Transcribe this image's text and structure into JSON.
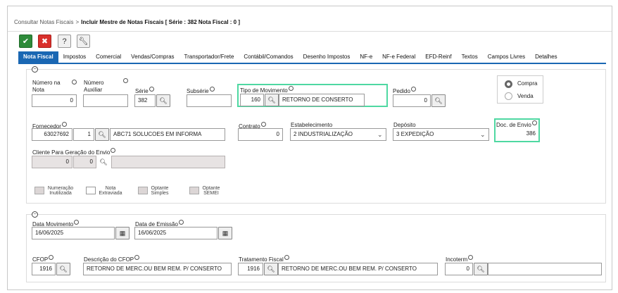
{
  "breadcrumb": {
    "parent": "Consultar Notas Fiscais",
    "separator": ">",
    "current": "Incluir Mestre de Notas Fiscais [ Série : 382 Nota Fiscal : 0 ]"
  },
  "toolbar": {
    "confirm_icon": "check-icon",
    "cancel_icon": "close-icon",
    "help_label": "?",
    "tools_icon": "wrench-icon"
  },
  "tabs": [
    "Nota Fiscal",
    "Impostos",
    "Comercial",
    "Vendas/Compras",
    "Transportador/Frete",
    "Contábil/Comandos",
    "Desenho Impostos",
    "NF-e",
    "NF-e Federal",
    "EFD-Reinf",
    "Textos",
    "Campos Livres",
    "Detalhes"
  ],
  "fields": {
    "numero_nota": {
      "label1": "Número na",
      "label2": "Nota",
      "value": "0"
    },
    "numero_auxiliar": {
      "label1": "Número",
      "label2": "Auxiliar",
      "value": ""
    },
    "serie": {
      "label": "Série",
      "value": "382"
    },
    "subserie": {
      "label": "Subsérie",
      "value": ""
    },
    "tipo_movimento": {
      "label": "Tipo de Movimento",
      "code": "160",
      "description": "RETORNO DE CONSERTO"
    },
    "pedido": {
      "label": "Pedido",
      "value": "0"
    },
    "operacao": {
      "options": [
        "Compra",
        "Venda"
      ],
      "selected": "Compra"
    },
    "fornecedor": {
      "label": "Fornecedor",
      "code": "63027692",
      "seq": "1",
      "name": "ABC71 SOLUCOES EM INFORMA"
    },
    "contrato": {
      "label": "Contrato",
      "value": "0"
    },
    "estabelecimento": {
      "label": "Estabelecimento",
      "value": "2 INDUSTRIALIZAÇÃO"
    },
    "deposito": {
      "label": "Depósito",
      "value": "3 EXPEDIÇÃO"
    },
    "doc_envio": {
      "label": "Doc. de Envio",
      "value": "386"
    },
    "cliente_envio": {
      "label": "Cliente Para Geração do Envio",
      "code": "0",
      "seq": "0",
      "name": ""
    },
    "checkboxes": [
      {
        "line1": "Numeração",
        "line2": "Inutilizada"
      },
      {
        "line1": "Nota",
        "line2": "Extraviada"
      },
      {
        "line1": "Optante",
        "line2": "Simples"
      },
      {
        "line1": "Optante",
        "line2": "SEMEI"
      }
    ],
    "data_movimento": {
      "label": "Data Movimento",
      "value": "16/06/2025"
    },
    "data_emissao": {
      "label": "Data de Emissão",
      "value": "16/06/2025"
    },
    "cfop": {
      "label": "CFOP",
      "value": "1916"
    },
    "descricao_cfop": {
      "label": "Descrição do CFOP",
      "value": "RETORNO DE MERC.OU BEM REM. P/ CONSERTO"
    },
    "tratamento_fiscal": {
      "label": "Tratamento Fiscal",
      "code": "1916",
      "value": "RETORNO DE MERC.OU BEM REM. P/ CONSERTO"
    },
    "incoterm": {
      "label": "Incoterm",
      "code": "0",
      "value": ""
    }
  },
  "colors": {
    "active_tab": "#1a67b3",
    "highlight": "#4fd8a2",
    "confirm": "#2e8b3a",
    "cancel": "#d9302c"
  }
}
